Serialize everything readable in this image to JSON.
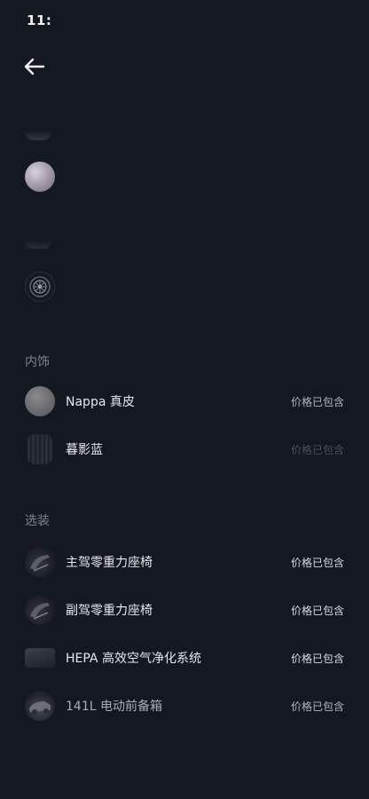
{
  "status_bar": {
    "time": "11:"
  },
  "exterior": {
    "icons": [
      "paint-swatch-icon",
      "wheel-icon"
    ]
  },
  "interior": {
    "section_title": "内饰",
    "items": [
      {
        "label": "Nappa 真皮",
        "price": "价格已包含",
        "icon": "nappa-leather-icon"
      },
      {
        "label": "暮影蓝",
        "price": "价格已包含",
        "icon": "twilight-blue-icon"
      }
    ]
  },
  "options": {
    "section_title": "选装",
    "items": [
      {
        "label": "主驾零重力座椅",
        "price": "价格已包含",
        "icon": "driver-seat-icon"
      },
      {
        "label": "副驾零重力座椅",
        "price": "价格已包含",
        "icon": "passenger-seat-icon"
      },
      {
        "label": "HEPA 高效空气净化系统",
        "price": "价格已包含",
        "icon": "air-filter-icon"
      },
      {
        "label": "141L 电动前备箱",
        "price": "价格已包含",
        "icon": "front-trunk-icon"
      }
    ]
  }
}
